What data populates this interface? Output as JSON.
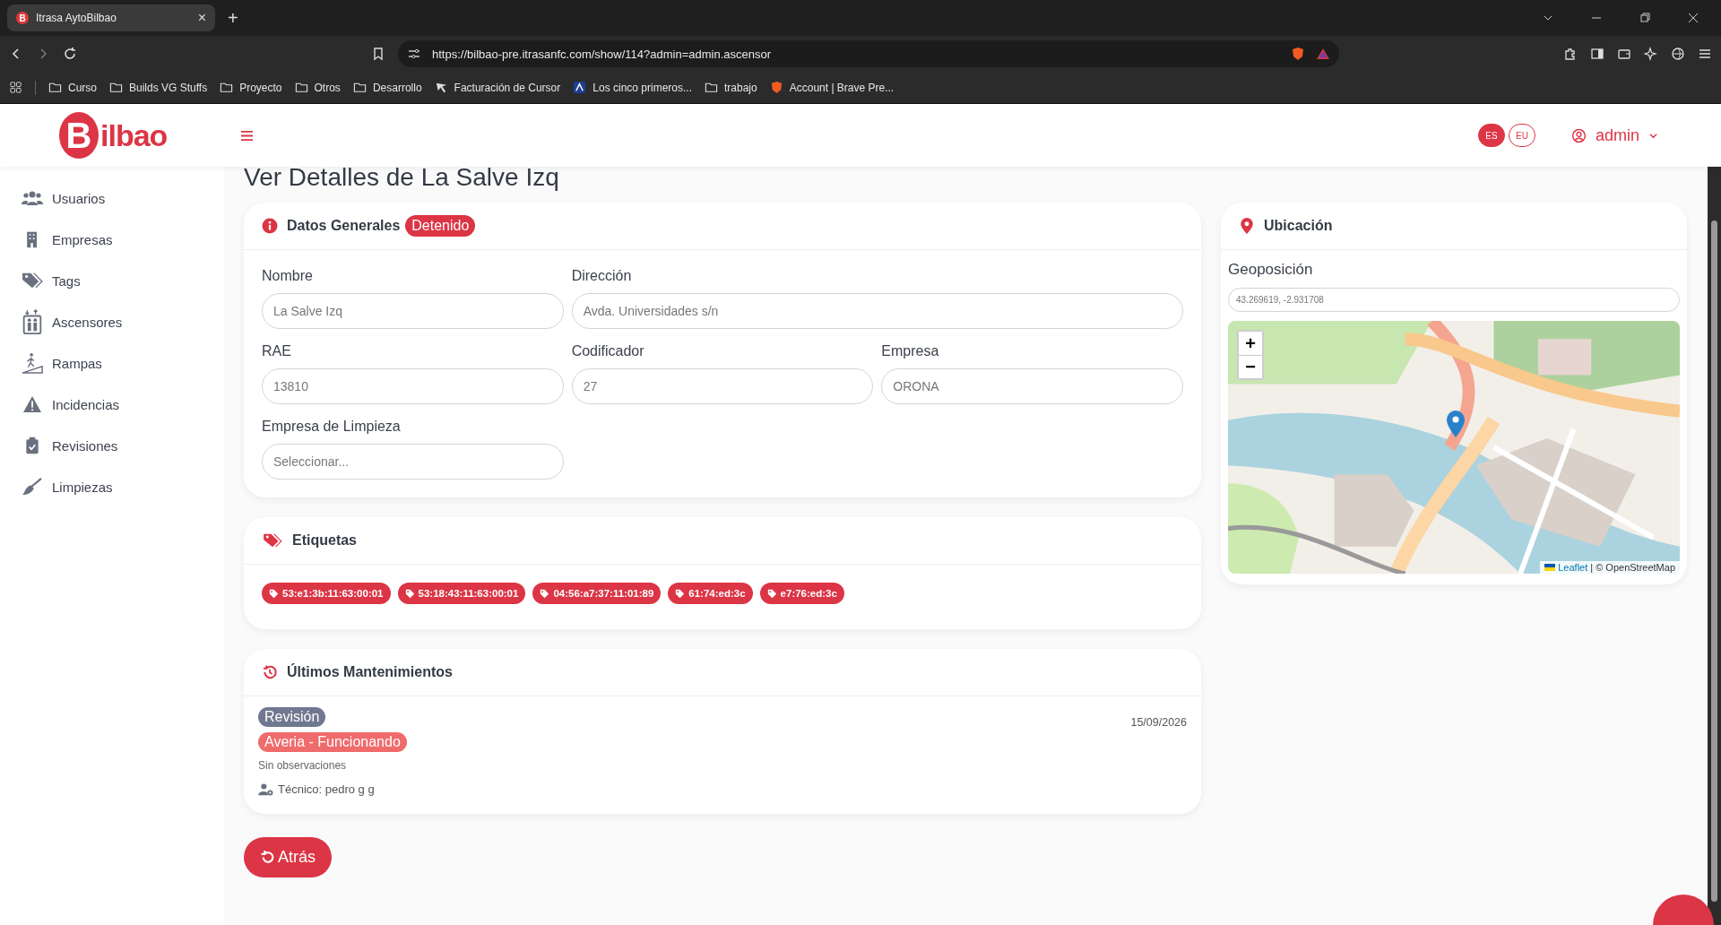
{
  "browser": {
    "tab_title": "Itrasa AytoBilbao",
    "tab_favicon": "B",
    "tab_close": "×",
    "new_tab": "+",
    "url": "https://bilbao-pre.itrasanfc.com/show/114?admin=admin.ascensor",
    "bookmarks": [
      {
        "label": "Curso",
        "kind": "folder"
      },
      {
        "label": "Builds VG Stuffs",
        "kind": "folder"
      },
      {
        "label": "Proyecto",
        "kind": "folder"
      },
      {
        "label": "Otros",
        "kind": "folder"
      },
      {
        "label": "Desarrollo",
        "kind": "folder"
      },
      {
        "label": "Facturación de Cursor",
        "kind": "cursor"
      },
      {
        "label": "Los cinco primeros...",
        "kind": "letter"
      },
      {
        "label": "trabajo",
        "kind": "folder"
      },
      {
        "label": "Account | Brave Pre...",
        "kind": "shield"
      }
    ]
  },
  "header": {
    "logo_initial": "B",
    "logo_text": "ilbao",
    "languages": [
      {
        "label": "ES",
        "selected": true
      },
      {
        "label": "EU",
        "selected": false
      }
    ],
    "user": "admin"
  },
  "sidebar": {
    "items": [
      {
        "label": "Usuarios",
        "kind": "users"
      },
      {
        "label": "Empresas",
        "kind": "building"
      },
      {
        "label": "Tags",
        "kind": "tags"
      },
      {
        "label": "Ascensores",
        "kind": "elevator"
      },
      {
        "label": "Rampas",
        "kind": "ramp"
      },
      {
        "label": "Incidencias",
        "kind": "warning"
      },
      {
        "label": "Revisiones",
        "kind": "clipboard"
      },
      {
        "label": "Limpiezas",
        "kind": "broom"
      }
    ]
  },
  "page_title": "Ver Detalles de La Salve Izq",
  "general": {
    "title": "Datos Generales",
    "status": "Detenido",
    "rows": [
      [
        {
          "label": "Nombre",
          "value": "La Salve Izq"
        },
        {
          "label": "Dirección",
          "value": "Avda. Universidades s/n"
        }
      ],
      [
        {
          "label": "RAE",
          "value": "13810"
        },
        {
          "label": "Codificador",
          "value": "27"
        },
        {
          "label": "Empresa",
          "value": "ORONA"
        }
      ],
      [
        {
          "label": "Empresa de Limpieza",
          "placeholder": "Seleccionar..."
        }
      ]
    ]
  },
  "location": {
    "title": "Ubicación",
    "label": "Geoposición",
    "value": "43.269619, -2.931708",
    "zoom_in": "+",
    "zoom_out": "−",
    "attribution_link": "Leaflet",
    "attribution": "| © OpenStreetMap"
  },
  "tags": {
    "title": "Etiquetas",
    "items": [
      "53:e1:3b:11:63:00:01",
      "53:18:43:11:63:00:01",
      "04:56:a7:37:11:01:89",
      "61:74:ed:3c",
      "e7:76:ed:3c"
    ]
  },
  "maintenance": {
    "title": "Últimos Mantenimientos",
    "entries": [
      {
        "type": "Revisión",
        "status": "Averia - Funcionando",
        "date": "15/09/2026",
        "notes": "Sin observaciones",
        "technician": "Técnico: pedro g g"
      }
    ]
  },
  "back_button": "Atrás"
}
